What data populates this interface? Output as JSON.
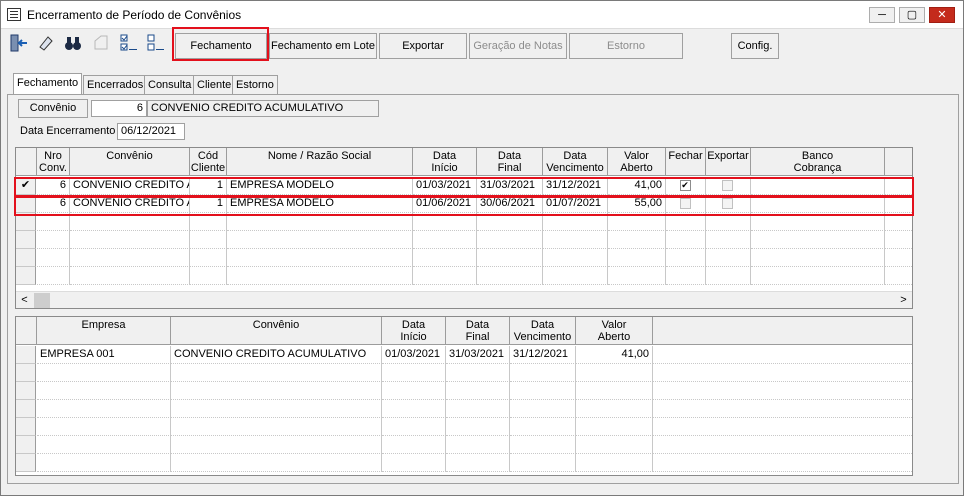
{
  "window": {
    "title": "Encerramento de Período de Convênios",
    "controls": [
      "─",
      "▢",
      "✕"
    ]
  },
  "toolbar": {
    "buttons": [
      {
        "label": "Fechamento",
        "disabled": false
      },
      {
        "label": "Fechamento em Lote",
        "disabled": false
      },
      {
        "label": "Exportar",
        "disabled": false
      },
      {
        "label": "Geração de Notas",
        "disabled": true
      },
      {
        "label": "Estorno",
        "disabled": true
      },
      {
        "label": "Config.",
        "disabled": false
      }
    ]
  },
  "tabs": [
    "Fechamento",
    "Encerrados",
    "Consulta",
    "Cliente",
    "Estorno"
  ],
  "form": {
    "convenio_button": "Convênio",
    "convenio_number": "6",
    "convenio_name": "CONVENIO CREDITO ACUMULATIVO",
    "data_encerramento_label": "Data Encerramento",
    "data_encerramento_value": "06/12/2021"
  },
  "grid1": {
    "headers": [
      {
        "l1": "Nro",
        "l2": "Conv."
      },
      {
        "l1": "Convênio",
        "l2": ""
      },
      {
        "l1": "Cód",
        "l2": "Cliente"
      },
      {
        "l1": "Nome / Razão Social",
        "l2": ""
      },
      {
        "l1": "Data",
        "l2": "Início"
      },
      {
        "l1": "Data",
        "l2": "Final"
      },
      {
        "l1": "Data",
        "l2": "Vencimento"
      },
      {
        "l1": "Valor",
        "l2": "Aberto"
      },
      {
        "l1": "Fechar",
        "l2": ""
      },
      {
        "l1": "Exportar",
        "l2": ""
      },
      {
        "l1": "Banco",
        "l2": "Cobrança"
      }
    ],
    "rows": [
      {
        "indicator": "✔",
        "nro": "6",
        "convenio": "CONVENIO CREDITO ACUMULATIVO",
        "cod": "1",
        "nome": "EMPRESA MODELO",
        "inicio": "01/03/2021",
        "final": "31/03/2021",
        "vencimento": "31/12/2021",
        "valor": "41,00",
        "fechar": "✔",
        "exportar": ""
      },
      {
        "indicator": "",
        "nro": "6",
        "convenio": "CONVENIO CREDITO ACUMULATIVO",
        "cod": "1",
        "nome": "EMPRESA MODELO",
        "inicio": "01/06/2021",
        "final": "30/06/2021",
        "vencimento": "01/07/2021",
        "valor": "55,00",
        "fechar": "",
        "exportar": ""
      }
    ],
    "scroll_left": "<",
    "scroll_right": ">"
  },
  "grid2": {
    "headers": [
      {
        "l1": "Empresa",
        "l2": ""
      },
      {
        "l1": "Convênio",
        "l2": ""
      },
      {
        "l1": "Data",
        "l2": "Início"
      },
      {
        "l1": "Data",
        "l2": "Final"
      },
      {
        "l1": "Data",
        "l2": "Vencimento"
      },
      {
        "l1": "Valor",
        "l2": "Aberto"
      }
    ],
    "rows": [
      {
        "empresa": "EMPRESA 001",
        "convenio": "CONVENIO CREDITO ACUMULATIVO",
        "inicio": "01/03/2021",
        "final": "31/03/2021",
        "vencimento": "31/12/2021",
        "valor": "41,00"
      }
    ]
  },
  "colors": {
    "highlight": "#e3101c",
    "title_bar": "#ffffff",
    "close_button": "#c42b1c"
  }
}
